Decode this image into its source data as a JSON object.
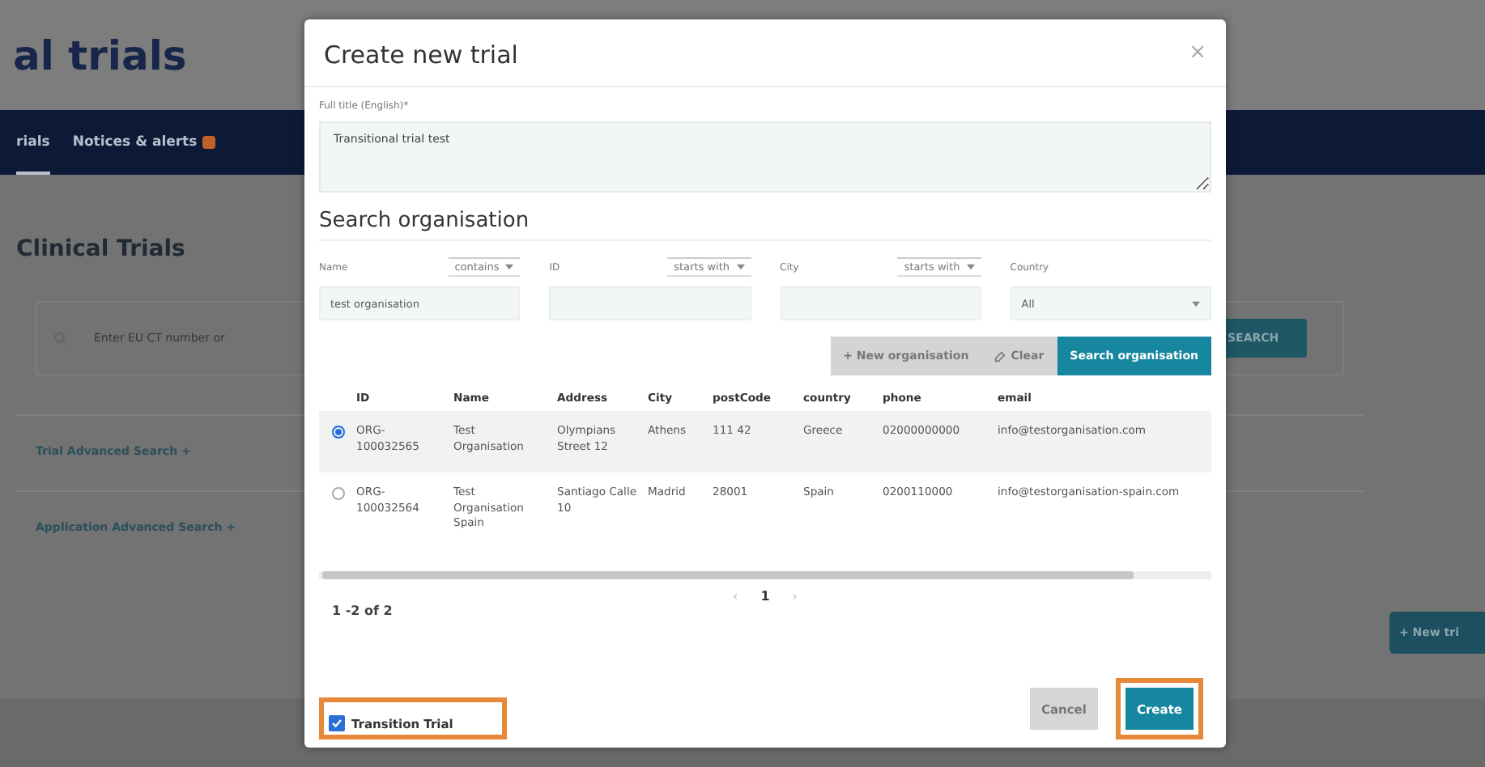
{
  "page": {
    "title": "al trials",
    "nav": [
      {
        "label": "rials",
        "selected": true,
        "badge": false
      },
      {
        "label": "Notices & alerts",
        "selected": false,
        "badge": true
      }
    ],
    "heading": "Clinical Trials",
    "search": {
      "placeholder": "Enter EU CT number or",
      "button": "SEARCH"
    },
    "accordions": [
      {
        "label": "Trial Advanced Search +",
        "expanded": false
      },
      {
        "label": "Application Advanced Search +",
        "expanded": false
      }
    ],
    "new_button": "+ New tri"
  },
  "dialog": {
    "title": "Create new trial",
    "close": "×",
    "full_title": {
      "label": "Full title (English)*",
      "value": "Transitional trial test"
    },
    "section": "Search organisation",
    "filters": [
      {
        "label": "Name",
        "operator": "contains",
        "value": "test organisation",
        "kind": "text"
      },
      {
        "label": "ID",
        "operator": "starts with",
        "kind": "text"
      },
      {
        "label": "City",
        "operator": "starts with",
        "kind": "text"
      },
      {
        "label": "Country",
        "value": "All",
        "kind": "select"
      }
    ],
    "actions": [
      {
        "label": "+ New organisation",
        "kind": "secondary"
      },
      {
        "label": "Clear",
        "kind": "clear"
      },
      {
        "label": "Search organisation",
        "kind": "primary"
      }
    ],
    "table": {
      "columns": [
        "ID",
        "Name",
        "Address",
        "City",
        "postCode",
        "country",
        "phone",
        "email"
      ],
      "rows": [
        {
          "selected": true,
          "cells": [
            "ORG-100032565",
            "Test Organisation",
            "Olympians Street 12",
            "Athens",
            "111 42",
            "Greece",
            "02000000000",
            "info@testorganisation.com"
          ]
        },
        {
          "selected": false,
          "cells": [
            "ORG-100032564",
            "Test Organisation Spain",
            "Santiago Calle 10",
            "Madrid",
            "28001",
            "Spain",
            "0200110000",
            "info@testorganisation-spain.com"
          ]
        }
      ]
    },
    "pagination": {
      "prev": "‹",
      "page": "1",
      "next": "›",
      "count": "1 -2 of 2"
    },
    "transition": {
      "label": "Transition Trial",
      "checked": true,
      "highlighted": true
    },
    "buttons": [
      {
        "label": "Cancel",
        "kind": "cancel",
        "highlighted": false
      },
      {
        "label": "Create",
        "kind": "primary",
        "highlighted": true
      }
    ]
  }
}
